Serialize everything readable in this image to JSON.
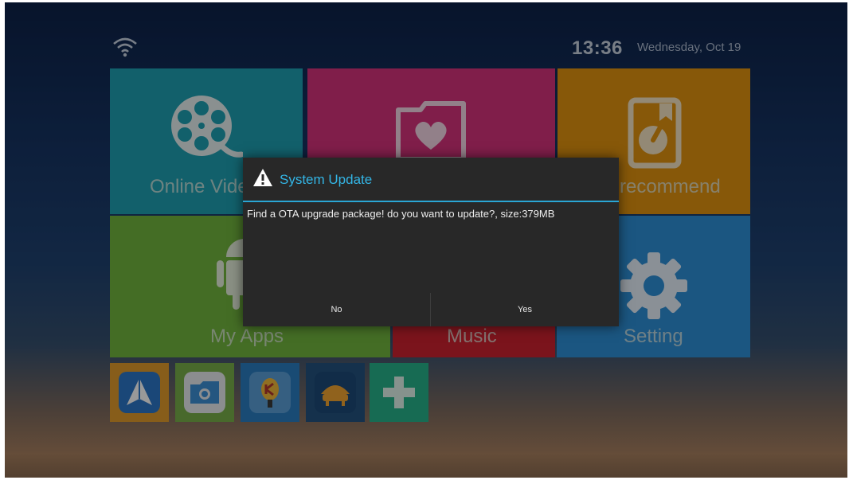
{
  "status": {
    "time": "13:36",
    "date": "Wednesday, Oct 19",
    "wifi_icon": "wifi-icon"
  },
  "tiles": {
    "online_video": {
      "label": "Online Video",
      "icon": "film-reel-icon",
      "color": "#1ea0b2"
    },
    "favorites": {
      "icon": "folder-heart-icon",
      "color": "#d5327c"
    },
    "recommend": {
      "label": "recommend",
      "icon": "bookmark-arrow-icon",
      "color": "#e2930f"
    },
    "my_apps": {
      "label": "My Apps",
      "icon": "android-icon",
      "color": "#72b63e"
    },
    "music": {
      "label": "Music",
      "icon": "music-icon",
      "color": "#ce2230"
    },
    "setting": {
      "label": "Setting",
      "icon": "gear-icon",
      "color": "#2e8fd8"
    }
  },
  "shortcuts": [
    {
      "icon": "paper-plane-app-icon"
    },
    {
      "icon": "folder-app-icon"
    },
    {
      "icon": "karaoke-mic-app-icon"
    },
    {
      "icon": "sofa-tv-app-icon"
    },
    {
      "icon": "add-icon"
    }
  ],
  "dialog": {
    "title": "System Update",
    "message": "Find a OTA upgrade package! do you want to update?, size:379MB",
    "no_label": "No",
    "yes_label": "Yes",
    "accent": "#33b5e5"
  }
}
